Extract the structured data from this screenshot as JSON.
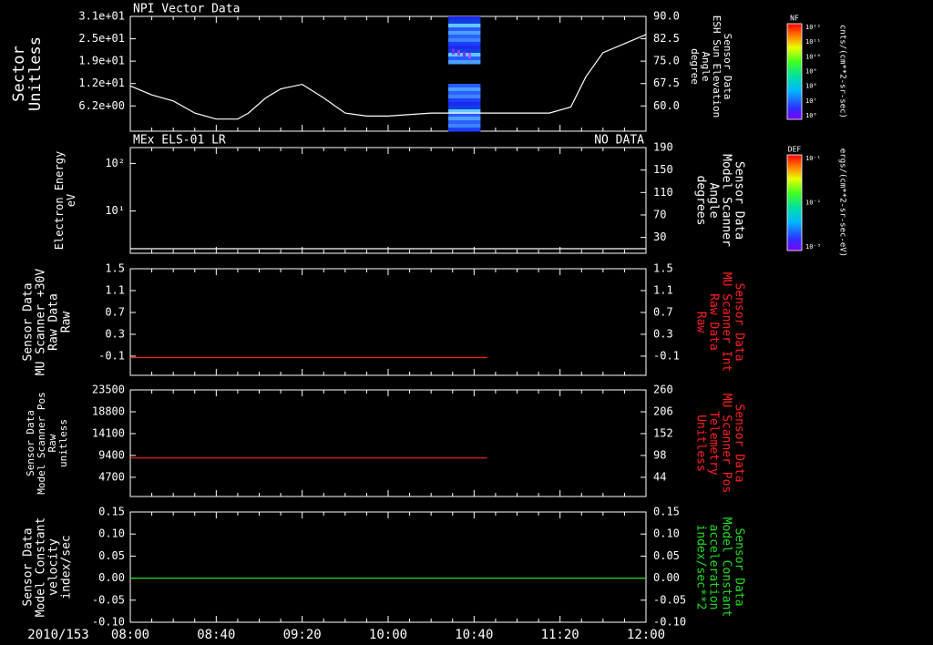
{
  "colors": {
    "white": "#ffffff",
    "red": "#ff2020",
    "green": "#22dd22",
    "bg": "#000000"
  },
  "x_axis": {
    "start_label": "2010/153",
    "ticks": [
      {
        "t": 0,
        "label": "08:00"
      },
      {
        "t": 40,
        "label": "08:40"
      },
      {
        "t": 80,
        "label": "09:20"
      },
      {
        "t": 120,
        "label": "10:00"
      },
      {
        "t": 160,
        "label": "10:40"
      },
      {
        "t": 200,
        "label": "11:20"
      },
      {
        "t": 240,
        "label": "12:00"
      }
    ],
    "range_minutes": [
      0,
      240
    ]
  },
  "colorbars": [
    {
      "title": "NF",
      "units": "cnts/(cm**2-sr-sec)",
      "tick_labels": [
        "10¹²",
        "10¹¹",
        "10¹⁰",
        "10⁹",
        "10⁸",
        "10⁷",
        "10⁶"
      ]
    },
    {
      "title": "DEF",
      "units": "ergs/(cm**2-sr-sec-eV)",
      "tick_labels": [
        "10⁻¹",
        "10⁻²",
        "10⁻³"
      ]
    }
  ],
  "chart_data": [
    {
      "type": "line",
      "title": "NPI Vector Data",
      "left_axis": {
        "label": [
          "Sector",
          "Unitless"
        ],
        "ticks": [
          "3.1e+01",
          "2.5e+01",
          "1.9e+01",
          "1.2e+01",
          "6.2e+00"
        ]
      },
      "right_axis": {
        "label": [
          "Sensor Data",
          "ESH Sun Elevation",
          "Angle",
          "degree"
        ],
        "ticks": [
          "90.0",
          "82.5",
          "75.0",
          "67.5",
          "60.0"
        ],
        "ylim": [
          52,
          90
        ]
      },
      "spectrogram_block": {
        "x_range_minutes": [
          148,
          163
        ],
        "gap_sector_range": [
          12.5,
          18.5
        ]
      },
      "series": [
        {
          "color": "white",
          "x": [
            0,
            10,
            20,
            30,
            40,
            50,
            55,
            63,
            70,
            80,
            90,
            100,
            110,
            120,
            140,
            160,
            180,
            185,
            195,
            205,
            212,
            220,
            240
          ],
          "y": [
            67,
            64,
            62,
            58,
            56,
            56,
            58,
            63,
            66,
            67.5,
            63,
            58,
            57,
            57,
            58,
            58,
            58,
            58,
            58,
            60,
            70,
            78,
            84
          ]
        }
      ]
    },
    {
      "type": "line",
      "title": "MEx ELS-01 LR",
      "note": "NO DATA",
      "left_axis": {
        "label": [
          "Electron Energy",
          "eV"
        ],
        "ticks": [
          "10²",
          "10¹"
        ]
      },
      "right_axis": {
        "label": [
          "Sensor Data",
          "Model Scanner",
          "Angle",
          "degrees"
        ],
        "ticks": [
          "190",
          "150",
          "110",
          "70",
          "30"
        ],
        "ylim": [
          1,
          190
        ]
      },
      "series": [
        {
          "color": "white",
          "x": [
            0,
            240
          ],
          "y": [
            10,
            10
          ]
        }
      ]
    },
    {
      "type": "line",
      "left_axis": {
        "label": [
          "Sensor Data",
          "MU Scanner +30V",
          "Raw Data",
          "Raw"
        ],
        "ticks": [
          "1.5",
          "1.1",
          "0.7",
          "0.3",
          "-0.1"
        ],
        "ylim": [
          -0.3,
          1.5
        ]
      },
      "right_axis": {
        "label": [
          "Sensor Data",
          "MU Scanner Int",
          "Raw Data",
          "Raw"
        ],
        "ticks": [
          "1.5",
          "1.1",
          "0.7",
          "0.3",
          "-0.1"
        ]
      },
      "series": [
        {
          "color": "red",
          "x": [
            0,
            166
          ],
          "y": [
            0,
            0
          ]
        }
      ]
    },
    {
      "type": "line",
      "left_axis": {
        "label": [
          "Sensor Data",
          "Model Scanner Pos",
          "Raw",
          "unitless"
        ],
        "ticks": [
          "23500",
          "18800",
          "14100",
          "9400",
          "4700"
        ],
        "ylim": [
          0,
          23500
        ]
      },
      "right_axis": {
        "label": [
          "Sensor Data",
          "MU Scanner Pos",
          "Telemetry",
          "Unitless"
        ],
        "ticks": [
          "260",
          "206",
          "152",
          "98",
          "44"
        ]
      },
      "series": [
        {
          "color": "red",
          "x": [
            0,
            166
          ],
          "y": [
            8500,
            8500
          ]
        }
      ]
    },
    {
      "type": "line",
      "left_axis": {
        "label": [
          "Sensor Data",
          "Model Constant",
          "velocity",
          "index/sec"
        ],
        "ticks": [
          "0.15",
          "0.10",
          "0.05",
          "0.00",
          "-0.05",
          "-0.10"
        ],
        "ylim": [
          -0.1,
          0.15
        ]
      },
      "right_axis": {
        "label": [
          "Sensor Data",
          "Model Constant",
          "acceleration",
          "index/sec**2"
        ],
        "ticks": [
          "0.15",
          "0.10",
          "0.05",
          "0.00",
          "-0.05",
          "-0.10"
        ]
      },
      "series": [
        {
          "color": "green",
          "x": [
            0,
            240
          ],
          "y": [
            0,
            0
          ]
        }
      ]
    }
  ]
}
